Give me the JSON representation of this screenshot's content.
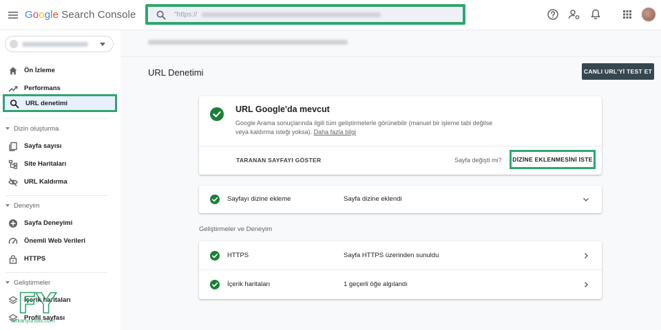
{
  "header": {
    "app_name": {
      "part1": "G",
      "part2": "o",
      "part3": "o",
      "part4": "g",
      "part5": "l",
      "part6": "e",
      "rest": " Search Console"
    },
    "search": {
      "value": "\"https://"
    },
    "icons": [
      "menu-icon",
      "search-icon",
      "help-icon",
      "manage-accounts-icon",
      "notifications-icon",
      "apps-icon",
      "avatar"
    ]
  },
  "sidebar": {
    "items": [
      {
        "label": "Ön İzleme",
        "icon": "home-icon"
      },
      {
        "label": "Performans",
        "icon": "trending-up-icon"
      },
      {
        "label": "URL denetimi",
        "icon": "search-icon",
        "active": true
      }
    ],
    "sections": [
      {
        "title": "Dizin oluşturma",
        "items": [
          {
            "label": "Sayfa sayısı",
            "icon": "pages-icon"
          },
          {
            "label": "Site Haritaları",
            "icon": "sitemap-icon"
          },
          {
            "label": "URL Kaldırma",
            "icon": "visibility-off-icon"
          }
        ]
      },
      {
        "title": "Deneyim",
        "items": [
          {
            "label": "Sayfa Deneyimi",
            "icon": "add-circle-icon"
          },
          {
            "label": "Önemli Web Verileri",
            "icon": "speed-icon"
          },
          {
            "label": "HTTPS",
            "icon": "lock-icon"
          }
        ]
      },
      {
        "title": "Geliştirmeler",
        "items": [
          {
            "label": "İçerik haritaları",
            "icon": "layers-icon"
          },
          {
            "label": "Profil sayfası",
            "icon": "layers-icon"
          }
        ]
      }
    ]
  },
  "watermark": {
    "logo": "FY",
    "site": "furkanyurttas.com"
  },
  "main": {
    "page_title": "URL Denetimi",
    "live_test_button": "CANLI URL'Yİ TEST ET",
    "status": {
      "title": "URL Google'da mevcut",
      "description": "Google Arama sonuçlarında ilgili tüm geliştirmelerle görünebilir (manuel bir işleme tabi değilse veya kaldırma isteği yoksa).",
      "learn_more": "Daha fazla bilgi",
      "show_crawled": "TARANAN SAYFAYI GÖSTER",
      "changed_question": "Sayfa değişti mi?",
      "request_indexing": "DİZİNE EKLENMESİNİ İSTE"
    },
    "indexing_row": {
      "label": "Sayfayı dizine ekleme",
      "value": "Sayfa dizine eklendi"
    },
    "enhancements_header": "Geliştirmeler ve Deneyim",
    "enhancement_rows": [
      {
        "label": "HTTPS",
        "value": "Sayfa HTTPS üzerinden sunuldu"
      },
      {
        "label": "İçerik haritaları",
        "value": "1 geçerli öğe algılandı"
      }
    ]
  },
  "colors": {
    "accent_green": "#2fa66d",
    "check_green": "#188038",
    "button_dark": "#37474f",
    "active_bg": "#e8f0fe"
  }
}
